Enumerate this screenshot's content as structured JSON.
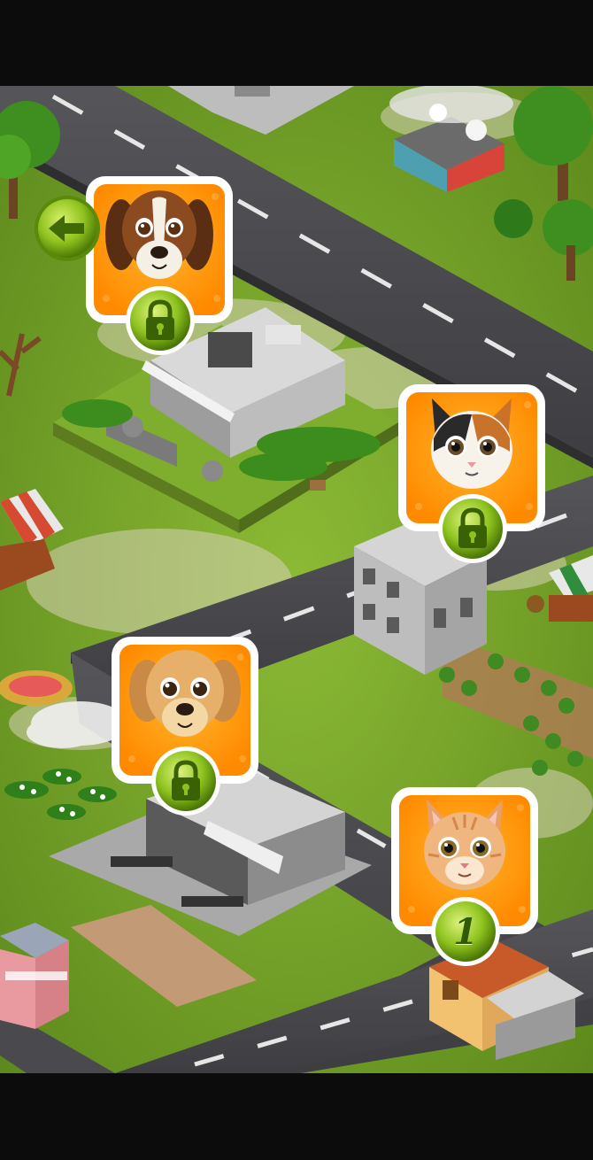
{
  "colors": {
    "grass": "#79a52a",
    "road": "#4a4a4e",
    "card_orange": "#ff9a00",
    "badge_green": "#8dc21e"
  },
  "back_button": {
    "icon": "arrow-left-icon"
  },
  "levels": [
    {
      "pet": "beagle-puppy",
      "state": "locked",
      "icon": "padlock-icon"
    },
    {
      "pet": "calico-kitten",
      "state": "locked",
      "icon": "padlock-icon"
    },
    {
      "pet": "golden-puppy",
      "state": "locked",
      "icon": "padlock-icon"
    },
    {
      "pet": "ginger-tabby-kitten",
      "state": "unlocked",
      "number": "1"
    }
  ]
}
